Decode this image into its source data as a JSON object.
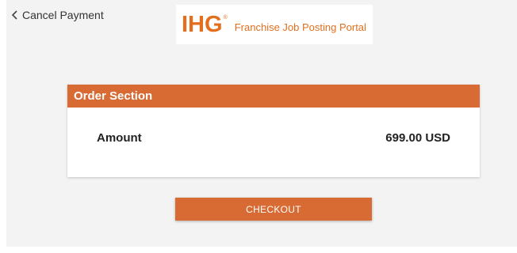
{
  "nav": {
    "cancel_label": "Cancel Payment",
    "back_icon": "chevron-left-icon"
  },
  "brand": {
    "logo_text": "IHG",
    "registered_mark": "®",
    "tagline": "Franchise Job Posting Portal",
    "color": "#e36f1e"
  },
  "order": {
    "title": "Order Section",
    "amount_label": "Amount",
    "amount_value": "699.00 USD",
    "header_color": "#d86b33"
  },
  "actions": {
    "checkout_label": "CHECKOUT",
    "button_color": "#d86b33"
  }
}
